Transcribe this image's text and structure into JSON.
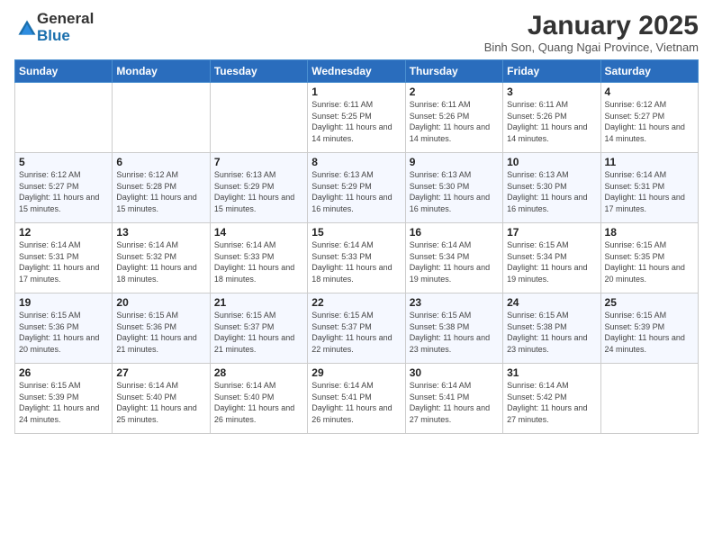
{
  "logo": {
    "general": "General",
    "blue": "Blue"
  },
  "header": {
    "month": "January 2025",
    "location": "Binh Son, Quang Ngai Province, Vietnam"
  },
  "days_of_week": [
    "Sunday",
    "Monday",
    "Tuesday",
    "Wednesday",
    "Thursday",
    "Friday",
    "Saturday"
  ],
  "weeks": [
    [
      {
        "day": "",
        "detail": ""
      },
      {
        "day": "",
        "detail": ""
      },
      {
        "day": "",
        "detail": ""
      },
      {
        "day": "1",
        "detail": "Sunrise: 6:11 AM\nSunset: 5:25 PM\nDaylight: 11 hours and 14 minutes."
      },
      {
        "day": "2",
        "detail": "Sunrise: 6:11 AM\nSunset: 5:26 PM\nDaylight: 11 hours and 14 minutes."
      },
      {
        "day": "3",
        "detail": "Sunrise: 6:11 AM\nSunset: 5:26 PM\nDaylight: 11 hours and 14 minutes."
      },
      {
        "day": "4",
        "detail": "Sunrise: 6:12 AM\nSunset: 5:27 PM\nDaylight: 11 hours and 14 minutes."
      }
    ],
    [
      {
        "day": "5",
        "detail": "Sunrise: 6:12 AM\nSunset: 5:27 PM\nDaylight: 11 hours and 15 minutes."
      },
      {
        "day": "6",
        "detail": "Sunrise: 6:12 AM\nSunset: 5:28 PM\nDaylight: 11 hours and 15 minutes."
      },
      {
        "day": "7",
        "detail": "Sunrise: 6:13 AM\nSunset: 5:29 PM\nDaylight: 11 hours and 15 minutes."
      },
      {
        "day": "8",
        "detail": "Sunrise: 6:13 AM\nSunset: 5:29 PM\nDaylight: 11 hours and 16 minutes."
      },
      {
        "day": "9",
        "detail": "Sunrise: 6:13 AM\nSunset: 5:30 PM\nDaylight: 11 hours and 16 minutes."
      },
      {
        "day": "10",
        "detail": "Sunrise: 6:13 AM\nSunset: 5:30 PM\nDaylight: 11 hours and 16 minutes."
      },
      {
        "day": "11",
        "detail": "Sunrise: 6:14 AM\nSunset: 5:31 PM\nDaylight: 11 hours and 17 minutes."
      }
    ],
    [
      {
        "day": "12",
        "detail": "Sunrise: 6:14 AM\nSunset: 5:31 PM\nDaylight: 11 hours and 17 minutes."
      },
      {
        "day": "13",
        "detail": "Sunrise: 6:14 AM\nSunset: 5:32 PM\nDaylight: 11 hours and 18 minutes."
      },
      {
        "day": "14",
        "detail": "Sunrise: 6:14 AM\nSunset: 5:33 PM\nDaylight: 11 hours and 18 minutes."
      },
      {
        "day": "15",
        "detail": "Sunrise: 6:14 AM\nSunset: 5:33 PM\nDaylight: 11 hours and 18 minutes."
      },
      {
        "day": "16",
        "detail": "Sunrise: 6:14 AM\nSunset: 5:34 PM\nDaylight: 11 hours and 19 minutes."
      },
      {
        "day": "17",
        "detail": "Sunrise: 6:15 AM\nSunset: 5:34 PM\nDaylight: 11 hours and 19 minutes."
      },
      {
        "day": "18",
        "detail": "Sunrise: 6:15 AM\nSunset: 5:35 PM\nDaylight: 11 hours and 20 minutes."
      }
    ],
    [
      {
        "day": "19",
        "detail": "Sunrise: 6:15 AM\nSunset: 5:36 PM\nDaylight: 11 hours and 20 minutes."
      },
      {
        "day": "20",
        "detail": "Sunrise: 6:15 AM\nSunset: 5:36 PM\nDaylight: 11 hours and 21 minutes."
      },
      {
        "day": "21",
        "detail": "Sunrise: 6:15 AM\nSunset: 5:37 PM\nDaylight: 11 hours and 21 minutes."
      },
      {
        "day": "22",
        "detail": "Sunrise: 6:15 AM\nSunset: 5:37 PM\nDaylight: 11 hours and 22 minutes."
      },
      {
        "day": "23",
        "detail": "Sunrise: 6:15 AM\nSunset: 5:38 PM\nDaylight: 11 hours and 23 minutes."
      },
      {
        "day": "24",
        "detail": "Sunrise: 6:15 AM\nSunset: 5:38 PM\nDaylight: 11 hours and 23 minutes."
      },
      {
        "day": "25",
        "detail": "Sunrise: 6:15 AM\nSunset: 5:39 PM\nDaylight: 11 hours and 24 minutes."
      }
    ],
    [
      {
        "day": "26",
        "detail": "Sunrise: 6:15 AM\nSunset: 5:39 PM\nDaylight: 11 hours and 24 minutes."
      },
      {
        "day": "27",
        "detail": "Sunrise: 6:14 AM\nSunset: 5:40 PM\nDaylight: 11 hours and 25 minutes."
      },
      {
        "day": "28",
        "detail": "Sunrise: 6:14 AM\nSunset: 5:40 PM\nDaylight: 11 hours and 26 minutes."
      },
      {
        "day": "29",
        "detail": "Sunrise: 6:14 AM\nSunset: 5:41 PM\nDaylight: 11 hours and 26 minutes."
      },
      {
        "day": "30",
        "detail": "Sunrise: 6:14 AM\nSunset: 5:41 PM\nDaylight: 11 hours and 27 minutes."
      },
      {
        "day": "31",
        "detail": "Sunrise: 6:14 AM\nSunset: 5:42 PM\nDaylight: 11 hours and 27 minutes."
      },
      {
        "day": "",
        "detail": ""
      }
    ]
  ]
}
